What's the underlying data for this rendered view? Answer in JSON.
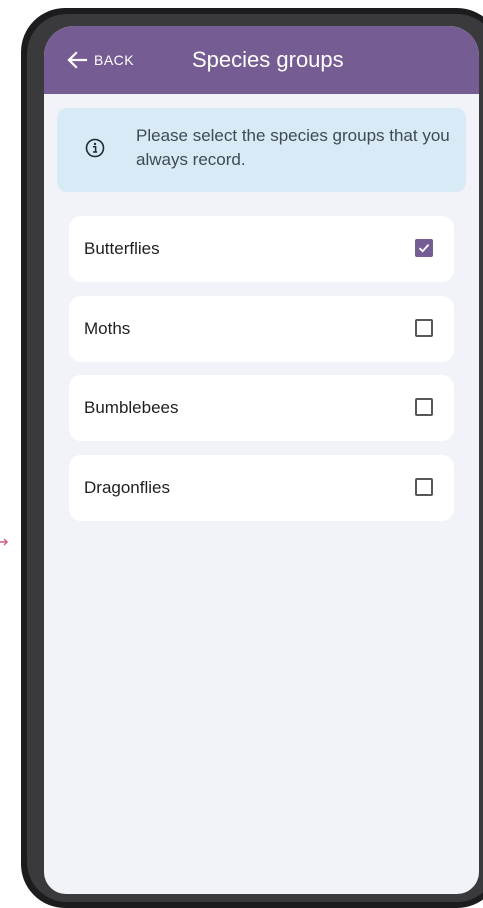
{
  "header": {
    "back_label": "BACK",
    "back_icon": "arrow-left-icon",
    "title": "Species groups",
    "color": "#755d93"
  },
  "info": {
    "icon": "info-icon",
    "text": "Please select the species groups that you always record.",
    "background": "#d8eaf5"
  },
  "options": [
    {
      "label": "Butterflies",
      "checked": true
    },
    {
      "label": "Moths",
      "checked": false
    },
    {
      "label": "Bumblebees",
      "checked": false
    },
    {
      "label": "Dragonflies",
      "checked": false
    }
  ],
  "colors": {
    "accent": "#755d93",
    "screen_background": "#f2f3f8",
    "card": "#ffffff",
    "edge_marker": "#d05b8a"
  }
}
